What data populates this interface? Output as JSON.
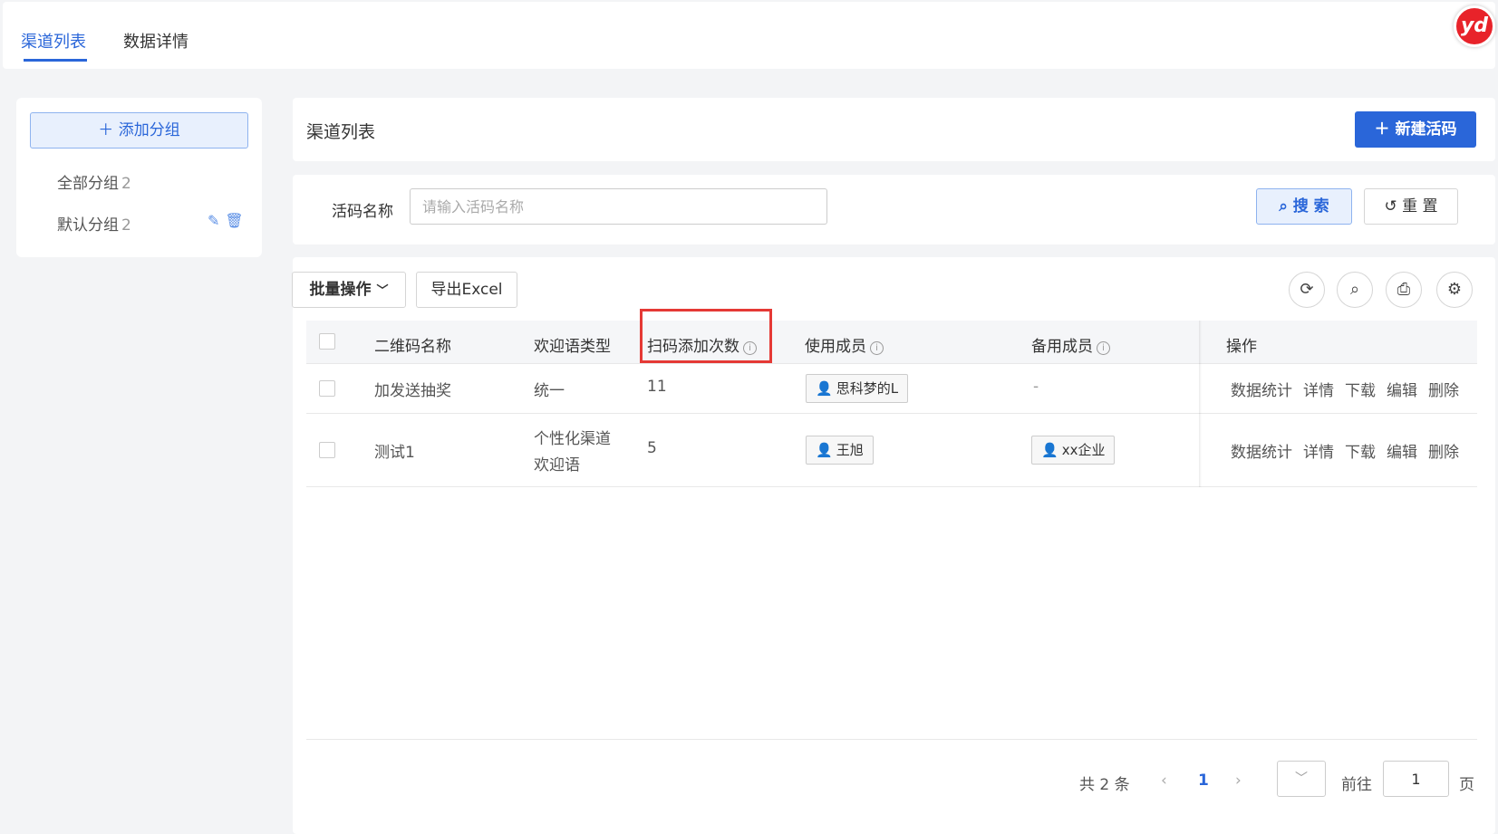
{
  "top_tabs": [
    {
      "label": "渠道列表",
      "active": true
    },
    {
      "label": "数据详情",
      "active": false
    }
  ],
  "logo_text": "yd",
  "sidebar": {
    "add_group_label": "添加分组",
    "groups": [
      {
        "name": "全部分组",
        "count": "2"
      },
      {
        "name": "默认分组",
        "count": "2"
      }
    ]
  },
  "header": {
    "title": "渠道列表",
    "new_button_label": "新建活码"
  },
  "search": {
    "label": "活码名称",
    "placeholder": "请输入活码名称",
    "search_button": "搜 索",
    "reset_button": "重 置"
  },
  "toolbar": {
    "batch_label": "批量操作",
    "export_label": "导出Excel"
  },
  "table": {
    "columns": [
      "二维码名称",
      "欢迎语类型",
      "扫码添加次数",
      "使用成员",
      "备用成员",
      "操作"
    ],
    "rows": [
      {
        "name": "加发送抽奖",
        "welcome_line1": "统一",
        "welcome_line2": "",
        "scans": "11",
        "member": "思科梦的L",
        "backup": "-",
        "ops": [
          "数据统计",
          "详情",
          "下载",
          "编辑",
          "删除"
        ]
      },
      {
        "name": "测试1",
        "welcome_line1": "个性化渠道",
        "welcome_line2": "欢迎语",
        "scans": "5",
        "member": "王旭",
        "backup": "xx企业",
        "ops": [
          "数据统计",
          "详情",
          "下载",
          "编辑",
          "删除"
        ]
      }
    ]
  },
  "pagination": {
    "total": "共 2 条",
    "current": "1",
    "goto_label": "前往",
    "goto_value": "1",
    "page_label": "页"
  },
  "colors": {
    "primary": "#2a66d9",
    "highlight": "#e53935",
    "logo": "#e8232a"
  }
}
